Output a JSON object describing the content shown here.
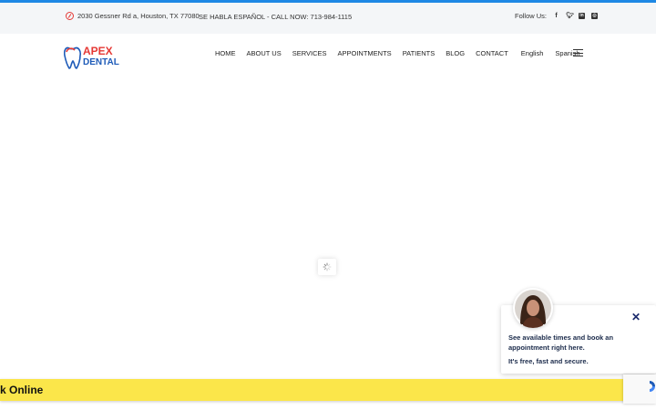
{
  "topbar": {
    "address": "2030 Gessner Rd a, Houston, TX 77080",
    "spanish_call": "SE HABLA ESPAÑOL - CALL NOW: 713-984-1115",
    "follow_label": "Follow Us:",
    "social_icons": [
      "facebook-icon",
      "twitter-icon",
      "linkedin-icon",
      "instagram-icon"
    ]
  },
  "logo": {
    "line1": "APEX",
    "line2": "DENTAL",
    "colors": {
      "red": "#e53935",
      "blue": "#1e5bb8"
    }
  },
  "nav": {
    "items": [
      "HOME",
      "ABOUT US",
      "SERVICES",
      "APPOINTMENTS",
      "PATIENTS",
      "BLOG",
      "CONTACT"
    ],
    "languages": [
      "English",
      "Spanish"
    ]
  },
  "popup": {
    "message": "See available times and book an appointment right here.",
    "subtext": "It's free, fast and secure."
  },
  "book_bar": {
    "label": "k Online",
    "color": "#fbe64a"
  },
  "colors": {
    "accent": "#1e88e5",
    "topbar_bg": "#f4f6f8"
  }
}
